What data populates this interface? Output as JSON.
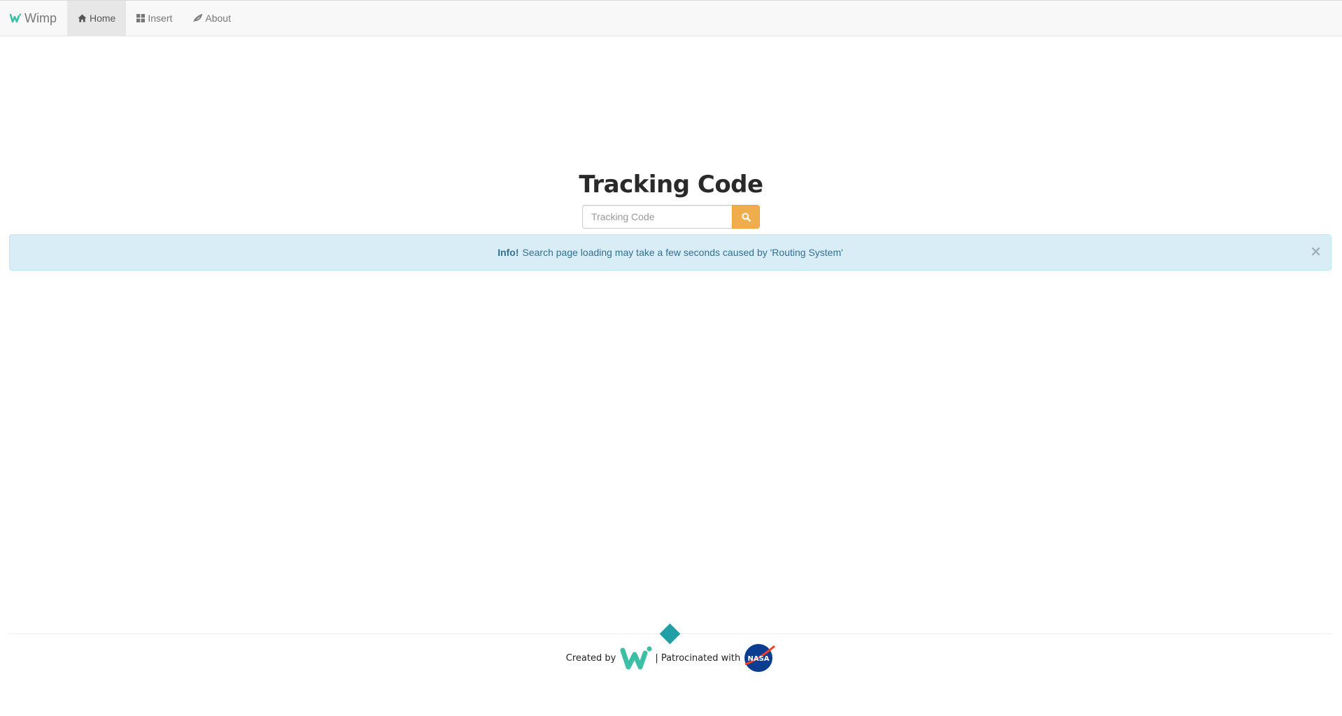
{
  "navbar": {
    "brand": "Wimp",
    "items": [
      {
        "label": "Home",
        "icon": "home-icon",
        "active": true
      },
      {
        "label": "Insert",
        "icon": "grid-icon",
        "active": false
      },
      {
        "label": "About",
        "icon": "leaf-icon",
        "active": false
      }
    ]
  },
  "hero": {
    "title": "Tracking Code"
  },
  "search": {
    "placeholder": "Tracking Code",
    "value": "",
    "button_icon": "search-icon"
  },
  "alert": {
    "strong": "Info!",
    "message": "Search page loading may take a few seconds caused by 'Routing System'",
    "close": "×"
  },
  "footer": {
    "created_by": "Created by",
    "separator_text": "| Patrocinated with",
    "logo_brand": "wi-logo",
    "logo_sponsor": "nasa-logo"
  },
  "colors": {
    "accent_orange": "#f0ad4e",
    "info_bg": "#d9edf7",
    "info_text": "#31708f",
    "teal": "#20a0a6"
  }
}
